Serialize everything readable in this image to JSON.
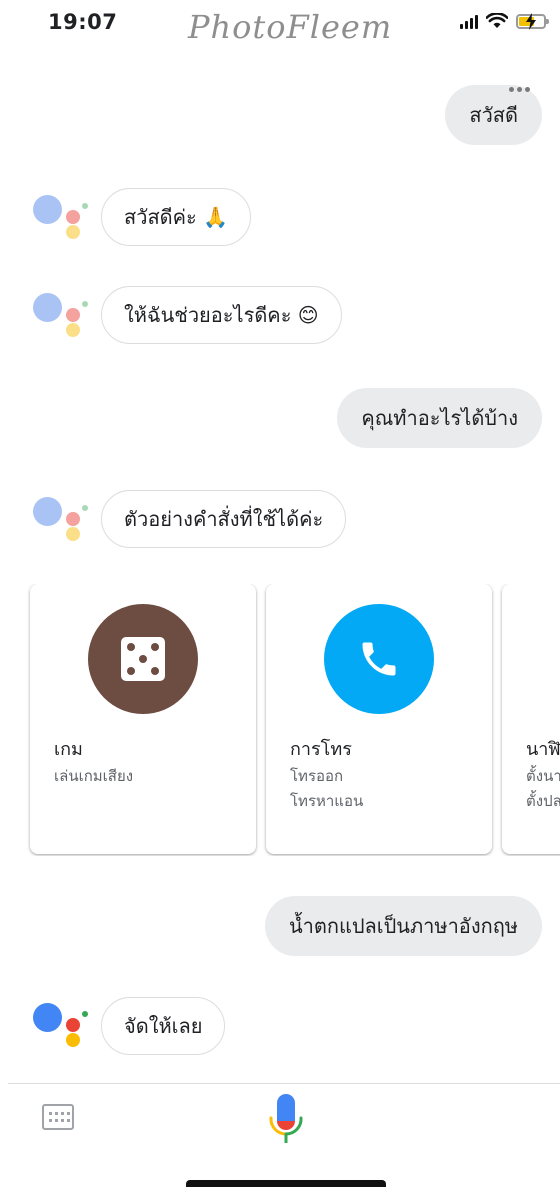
{
  "status_bar": {
    "time": "19:07",
    "watermark": "PhotoFleem",
    "icons": [
      "signal-icon",
      "wifi-icon",
      "battery-charging-icon"
    ]
  },
  "conversation": {
    "user_1": "สวัสดี",
    "assistant_1": "สวัสดีค่ะ 🙏",
    "assistant_2": "ให้ฉันช่วยอะไรดีคะ 😊",
    "user_2": "คุณทำอะไรได้บ้าง",
    "assistant_3": "ตัวอย่างคำสั่งที่ใช้ได้ค่ะ",
    "user_3": "น้ำตกแปลเป็นภาษาอังกฤษ",
    "assistant_4": "จัดให้เลย"
  },
  "cards": [
    {
      "title": "เกม",
      "lines": [
        "เล่นเกมเสียง"
      ],
      "icon": "dice-icon",
      "color": "#6d4c41"
    },
    {
      "title": "การโทร",
      "lines": [
        "โทรออก",
        "โทรหาแอน"
      ],
      "icon": "phone-icon",
      "color": "#03a9f4"
    },
    {
      "title": "นาฬิ",
      "lines": [
        "ตั้งนา",
        "ตั้งปล"
      ],
      "icon": "clock-icon",
      "color": "#e0e0e0"
    }
  ],
  "bottom_bar": {
    "keyboard_icon": "keyboard-icon",
    "mic_icon": "microphone-icon"
  },
  "colors": {
    "user_bubble": "#eaebed",
    "google_blue": "#4285f4",
    "google_red": "#ea4335",
    "google_yellow": "#fbbc05",
    "google_green": "#34a853"
  }
}
